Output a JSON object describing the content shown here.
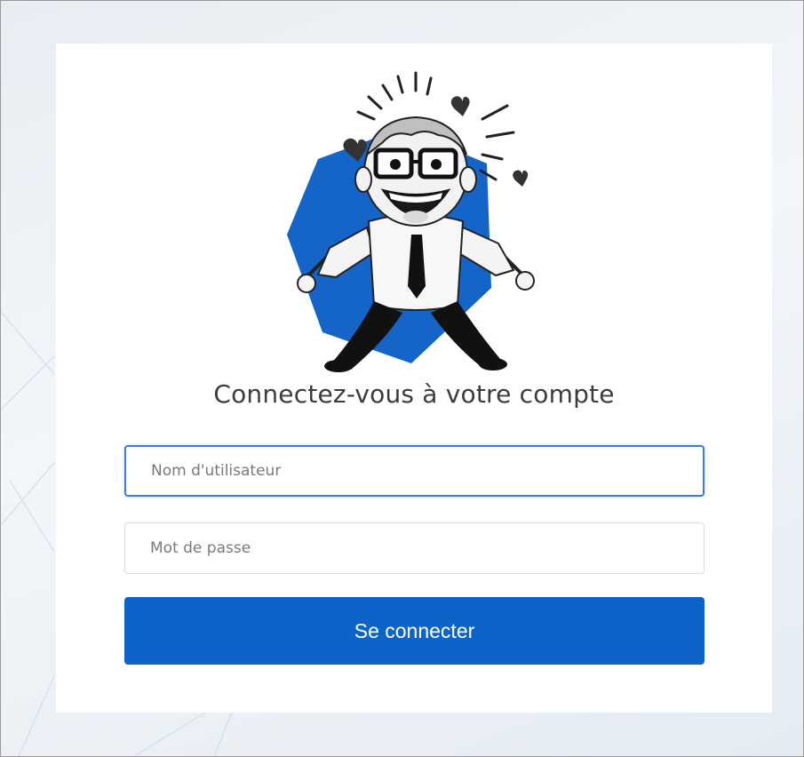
{
  "login": {
    "title": "Connectez-vous à votre compte",
    "username_placeholder": "Nom d'utilisateur",
    "password_placeholder": "Mot de passe",
    "submit_label": "Se connecter"
  },
  "colors": {
    "accent": "#0d64c8",
    "focus_border": "#3d7fd6",
    "card_bg": "#ffffff",
    "page_bg": "#eef2f6"
  },
  "icons": {
    "illustration": "excited-cartoon-man-on-blue-hexagon"
  }
}
